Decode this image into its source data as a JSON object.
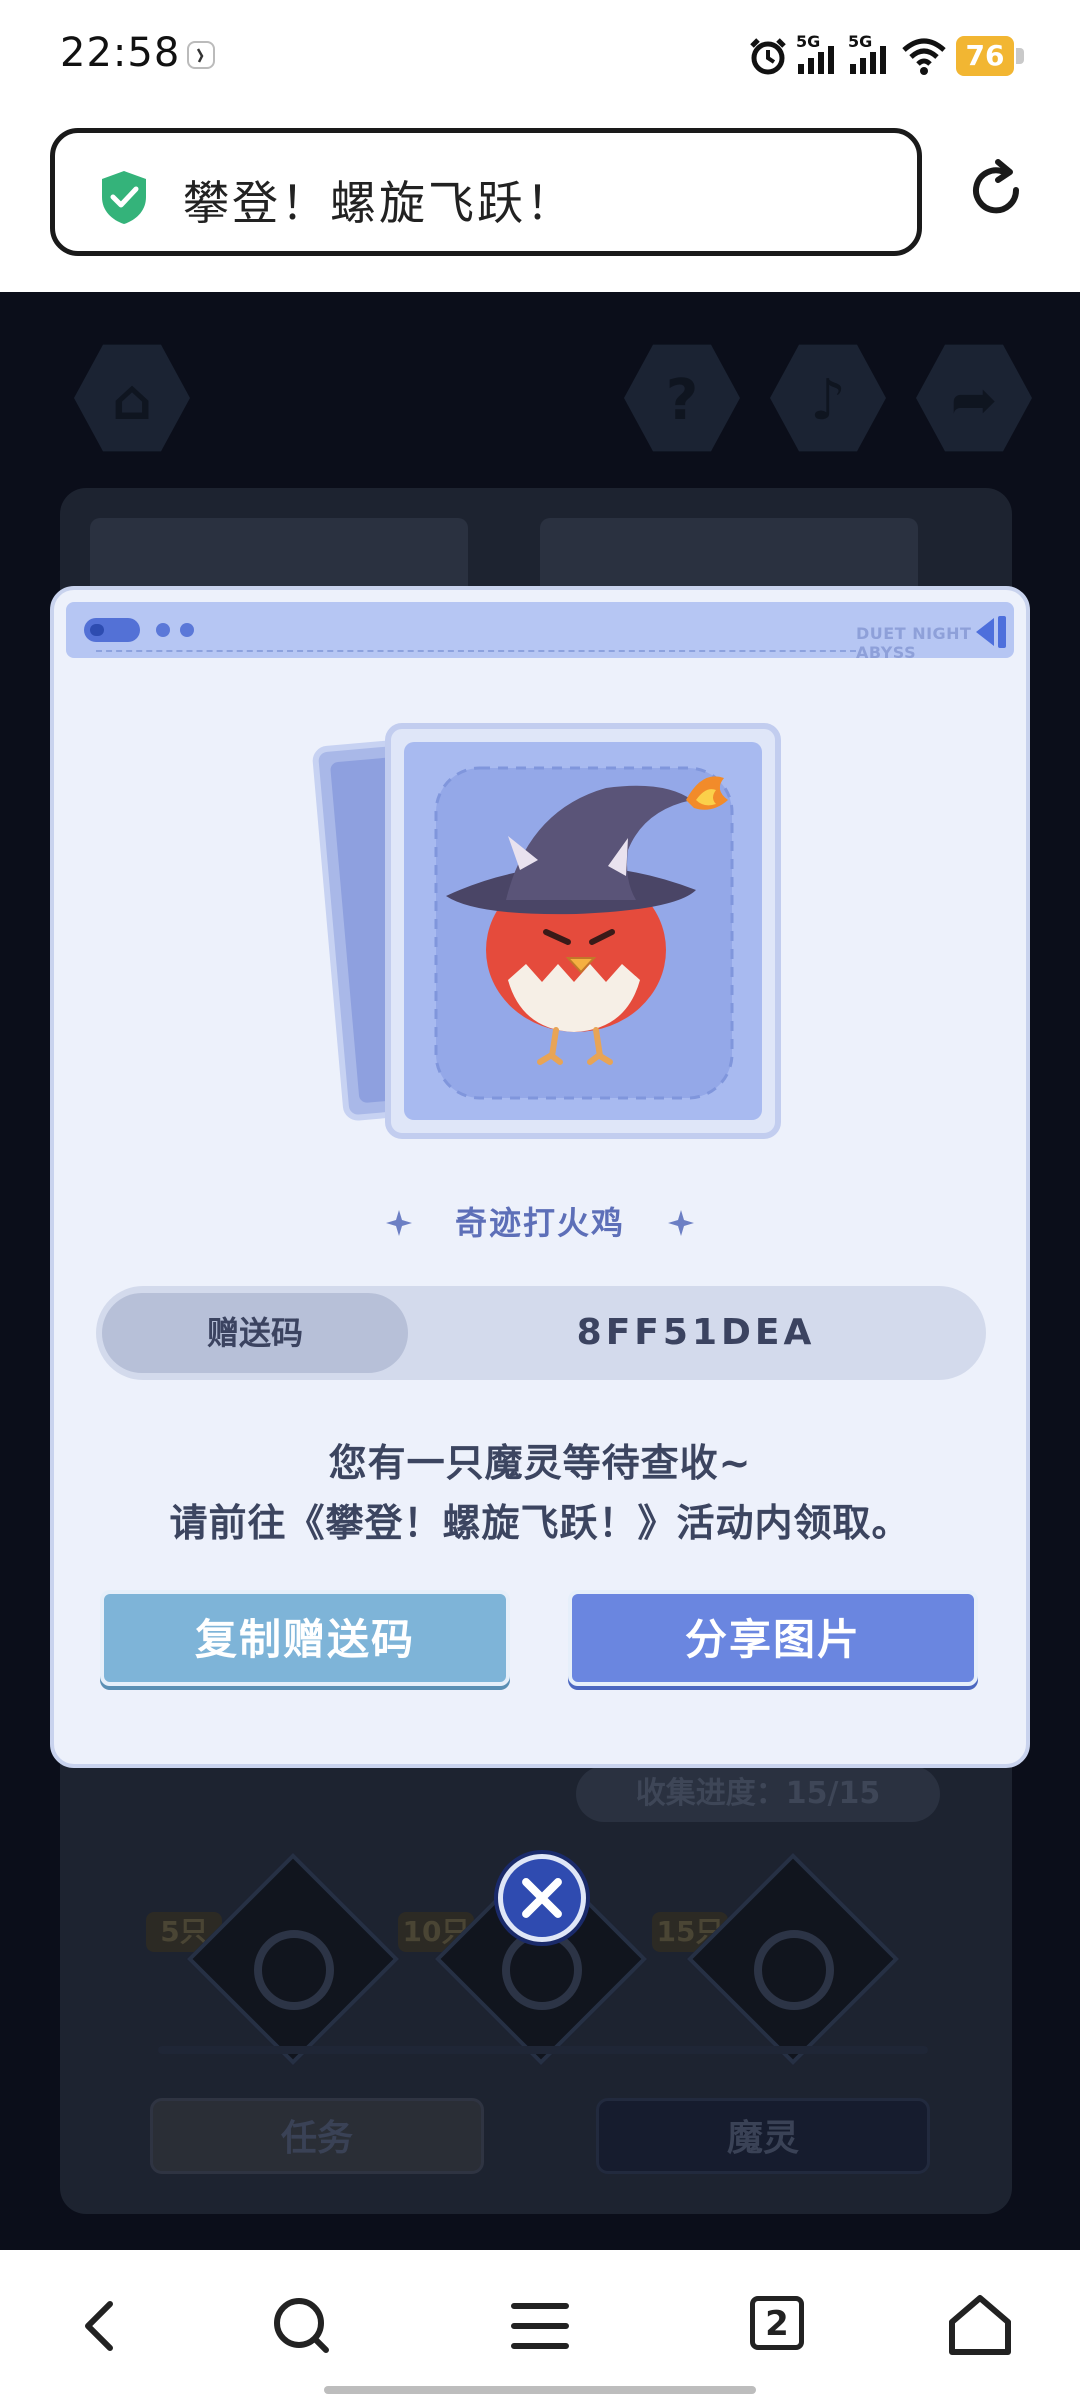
{
  "status_bar": {
    "time": "22:58",
    "network_1": "5G",
    "network_2": "5G",
    "battery": "76",
    "icons": [
      "alarm-icon",
      "signal-icon",
      "signal-icon",
      "wifi-icon"
    ]
  },
  "url_bar": {
    "title": "攀登！螺旋飞跃！",
    "secure_icon": "shield-check-icon",
    "reload_icon": "reload-icon"
  },
  "background": {
    "top_icons": [
      "home-icon",
      "help-icon",
      "music-icon",
      "share-icon"
    ],
    "progress_label": "收集进度：15/15",
    "milestones": [
      "5只",
      "10只",
      "15只"
    ],
    "buttons": [
      "任务",
      "魔灵"
    ]
  },
  "modal": {
    "header_text": "DUET NIGHT ABYSS",
    "pet_name": "奇迹打火鸡",
    "code_label": "赠送码",
    "code_value": "8FF51DEA",
    "message_line_1": "您有一只魔灵等待查收~",
    "message_line_2": "请前往《攀登！螺旋飞跃！》活动内领取。",
    "copy_button": "复制赠送码",
    "share_button": "分享图片"
  },
  "nav_bar": {
    "tab_count": "2",
    "items": [
      "back-icon",
      "search-icon",
      "menu-icon",
      "tabs-icon",
      "home-icon"
    ]
  },
  "colors": {
    "modal_bg": "#edf1fb",
    "copy_button": "#7eb4d8",
    "share_button": "#6a86e0",
    "battery": "#f2b632",
    "secure_green": "#34b37a"
  }
}
